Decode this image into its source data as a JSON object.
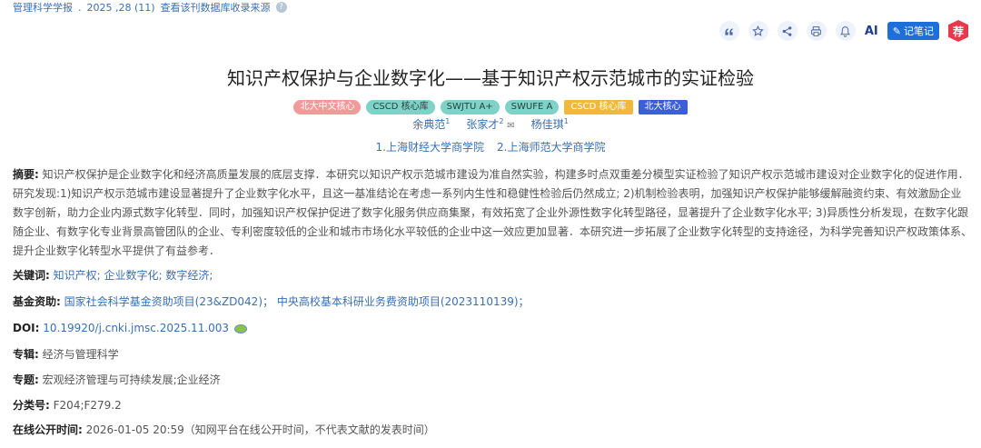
{
  "source": {
    "journal": "管理科学学报",
    "sep": ".",
    "issue": "2025 ,28 (11)",
    "db_link": "查看该刊数据库收录来源",
    "help_icon": "question-icon"
  },
  "toolbar": {
    "quote_icon": "quote-icon",
    "favorite_icon": "star-icon",
    "share_icon": "share-icon",
    "print_icon": "print-icon",
    "notify_icon": "bell-icon",
    "ai_label": "AI",
    "note_label": "记笔记",
    "recommend_label": "荐"
  },
  "article": {
    "title": "知识产权保护与企业数字化——基于知识产权示范城市的实证检验",
    "badges": [
      "北大中文核心",
      "CSCD 核心库",
      "SWJTU A+",
      "SWUFE A",
      "CSCD 核心库",
      "北大核心"
    ],
    "authors": [
      {
        "name": "余典范",
        "sup": "1"
      },
      {
        "name": "张家才",
        "sup": "2"
      },
      {
        "name": "杨佳琪",
        "sup": "1"
      }
    ],
    "affiliations": [
      "1.上海财经大学商学院",
      "2.上海师范大学商学院"
    ]
  },
  "details": {
    "abstract_label": "摘要:",
    "abstract": "知识产权保护是企业数字化和经济高质量发展的底层支撑．本研究以知识产权示范城市建设为准自然实验，构建多时点双重差分模型实证检验了知识产权示范城市建设对企业数字化的促进作用．研究发现:1)知识产权示范城市建设显著提升了企业数字化水平，且这一基准结论在考虑一系列内生性和稳健性检验后仍然成立; 2)机制检验表明，加强知识产权保护能够缓解融资约束、有效激励企业数字创新，助力企业内源式数字化转型．同时，加强知识产权保护促进了数字化服务供应商集聚，有效拓宽了企业外源性数字化转型路径，显著提升了企业数字化水平; 3)异质性分析发现，在数字化跟随企业、有数字化专业背景高管团队的企业、专利密度较低的企业和城市市场化水平较低的企业中这一效应更加显著．本研究进一步拓展了企业数字化转型的支持途径，为科学完善知识产权政策体系、提升企业数字化转型水平提供了有益参考．",
    "keywords_label": "关键词:",
    "keywords": [
      "知识产权;",
      "企业数字化;",
      "数字经济;"
    ],
    "funding_label": "基金资助:",
    "funding": [
      "国家社会科学基金资助项目(23&ZD042)；",
      "中央高校基本科研业务费资助项目(2023110139)；"
    ],
    "doi_label": "DOI:",
    "doi": "10.19920/j.cnki.jmsc.2025.11.003",
    "series_label": "专辑:",
    "series": "经济与管理科学",
    "subject_label": "专题:",
    "subject": "宏观经济管理与可持续发展;企业经济",
    "class_label": "分类号:",
    "class": "F204;F279.2",
    "pub_label": "在线公开时间:",
    "pub": "2026-01-05 20:59（知网平台在线公开时间，不代表文献的发表时间）"
  }
}
